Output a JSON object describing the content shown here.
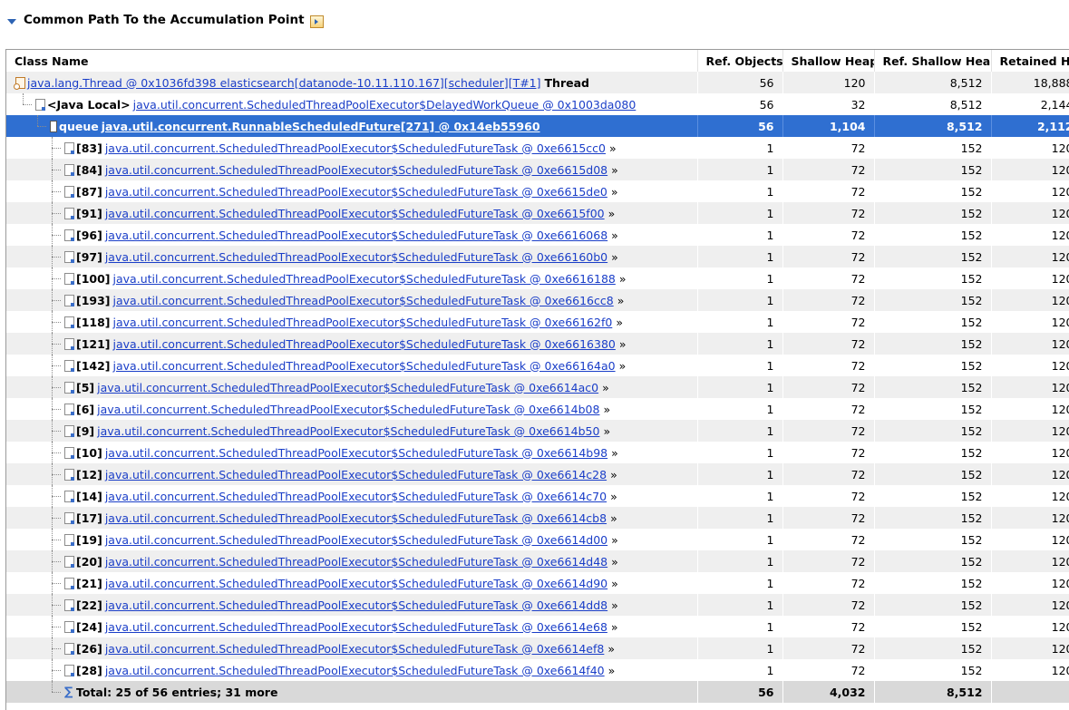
{
  "header": {
    "title": "Common Path To the Accumulation Point"
  },
  "columns": [
    "Class Name",
    "Ref. Objects",
    "Shallow Heap",
    "Ref. Shallow Heap",
    "Retained Heap"
  ],
  "rows": [
    {
      "level": 0,
      "icon": "thread",
      "label": "",
      "link": "java.lang.Thread @ 0x1036fd398 elasticsearch[datanode-10.11.110.167][scheduler][T#1]",
      "suffix": "Thread",
      "more": "",
      "ref": "56",
      "shallow": "120",
      "refshallow": "8,512",
      "retained": "18,888"
    },
    {
      "level": 1,
      "icon": "obj",
      "label": "<Java Local>",
      "link": "java.util.concurrent.ScheduledThreadPoolExecutor$DelayedWorkQueue @ 0x1003da080",
      "suffix": "",
      "more": "",
      "ref": "56",
      "shallow": "32",
      "refshallow": "8,512",
      "retained": "2,144"
    },
    {
      "level": 2,
      "icon": "arr",
      "label": "queue",
      "link": "java.util.concurrent.RunnableScheduledFuture[271] @ 0x14eb55960",
      "suffix": "",
      "more": "",
      "ref": "56",
      "shallow": "1,104",
      "refshallow": "8,512",
      "retained": "2,112",
      "selected": true
    },
    {
      "level": 3,
      "icon": "obj",
      "label": "[83]",
      "link": "java.util.concurrent.ScheduledThreadPoolExecutor$ScheduledFutureTask @ 0xe6615cc0",
      "more": "»",
      "ref": "1",
      "shallow": "72",
      "refshallow": "152",
      "retained": "120"
    },
    {
      "level": 3,
      "icon": "obj",
      "label": "[84]",
      "link": "java.util.concurrent.ScheduledThreadPoolExecutor$ScheduledFutureTask @ 0xe6615d08",
      "more": "»",
      "ref": "1",
      "shallow": "72",
      "refshallow": "152",
      "retained": "120"
    },
    {
      "level": 3,
      "icon": "obj",
      "label": "[87]",
      "link": "java.util.concurrent.ScheduledThreadPoolExecutor$ScheduledFutureTask @ 0xe6615de0",
      "more": "»",
      "ref": "1",
      "shallow": "72",
      "refshallow": "152",
      "retained": "120"
    },
    {
      "level": 3,
      "icon": "obj",
      "label": "[91]",
      "link": "java.util.concurrent.ScheduledThreadPoolExecutor$ScheduledFutureTask @ 0xe6615f00",
      "more": "»",
      "ref": "1",
      "shallow": "72",
      "refshallow": "152",
      "retained": "120"
    },
    {
      "level": 3,
      "icon": "obj",
      "label": "[96]",
      "link": "java.util.concurrent.ScheduledThreadPoolExecutor$ScheduledFutureTask @ 0xe6616068",
      "more": "»",
      "ref": "1",
      "shallow": "72",
      "refshallow": "152",
      "retained": "120"
    },
    {
      "level": 3,
      "icon": "obj",
      "label": "[97]",
      "link": "java.util.concurrent.ScheduledThreadPoolExecutor$ScheduledFutureTask @ 0xe66160b0",
      "more": "»",
      "ref": "1",
      "shallow": "72",
      "refshallow": "152",
      "retained": "120"
    },
    {
      "level": 3,
      "icon": "obj",
      "label": "[100]",
      "link": "java.util.concurrent.ScheduledThreadPoolExecutor$ScheduledFutureTask @ 0xe6616188",
      "more": "»",
      "ref": "1",
      "shallow": "72",
      "refshallow": "152",
      "retained": "120"
    },
    {
      "level": 3,
      "icon": "obj",
      "label": "[193]",
      "link": "java.util.concurrent.ScheduledThreadPoolExecutor$ScheduledFutureTask @ 0xe6616cc8",
      "more": "»",
      "ref": "1",
      "shallow": "72",
      "refshallow": "152",
      "retained": "120"
    },
    {
      "level": 3,
      "icon": "obj",
      "label": "[118]",
      "link": "java.util.concurrent.ScheduledThreadPoolExecutor$ScheduledFutureTask @ 0xe66162f0",
      "more": "»",
      "ref": "1",
      "shallow": "72",
      "refshallow": "152",
      "retained": "120"
    },
    {
      "level": 3,
      "icon": "obj",
      "label": "[121]",
      "link": "java.util.concurrent.ScheduledThreadPoolExecutor$ScheduledFutureTask @ 0xe6616380",
      "more": "»",
      "ref": "1",
      "shallow": "72",
      "refshallow": "152",
      "retained": "120"
    },
    {
      "level": 3,
      "icon": "obj",
      "label": "[142]",
      "link": "java.util.concurrent.ScheduledThreadPoolExecutor$ScheduledFutureTask @ 0xe66164a0",
      "more": "»",
      "ref": "1",
      "shallow": "72",
      "refshallow": "152",
      "retained": "120"
    },
    {
      "level": 3,
      "icon": "obj",
      "label": "[5]",
      "link": "java.util.concurrent.ScheduledThreadPoolExecutor$ScheduledFutureTask @ 0xe6614ac0",
      "more": "»",
      "ref": "1",
      "shallow": "72",
      "refshallow": "152",
      "retained": "120"
    },
    {
      "level": 3,
      "icon": "obj",
      "label": "[6]",
      "link": "java.util.concurrent.ScheduledThreadPoolExecutor$ScheduledFutureTask @ 0xe6614b08",
      "more": "»",
      "ref": "1",
      "shallow": "72",
      "refshallow": "152",
      "retained": "120"
    },
    {
      "level": 3,
      "icon": "obj",
      "label": "[9]",
      "link": "java.util.concurrent.ScheduledThreadPoolExecutor$ScheduledFutureTask @ 0xe6614b50",
      "more": "»",
      "ref": "1",
      "shallow": "72",
      "refshallow": "152",
      "retained": "120"
    },
    {
      "level": 3,
      "icon": "obj",
      "label": "[10]",
      "link": "java.util.concurrent.ScheduledThreadPoolExecutor$ScheduledFutureTask @ 0xe6614b98",
      "more": "»",
      "ref": "1",
      "shallow": "72",
      "refshallow": "152",
      "retained": "120"
    },
    {
      "level": 3,
      "icon": "obj",
      "label": "[12]",
      "link": "java.util.concurrent.ScheduledThreadPoolExecutor$ScheduledFutureTask @ 0xe6614c28",
      "more": "»",
      "ref": "1",
      "shallow": "72",
      "refshallow": "152",
      "retained": "120"
    },
    {
      "level": 3,
      "icon": "obj",
      "label": "[14]",
      "link": "java.util.concurrent.ScheduledThreadPoolExecutor$ScheduledFutureTask @ 0xe6614c70",
      "more": "»",
      "ref": "1",
      "shallow": "72",
      "refshallow": "152",
      "retained": "120"
    },
    {
      "level": 3,
      "icon": "obj",
      "label": "[17]",
      "link": "java.util.concurrent.ScheduledThreadPoolExecutor$ScheduledFutureTask @ 0xe6614cb8",
      "more": "»",
      "ref": "1",
      "shallow": "72",
      "refshallow": "152",
      "retained": "120"
    },
    {
      "level": 3,
      "icon": "obj",
      "label": "[19]",
      "link": "java.util.concurrent.ScheduledThreadPoolExecutor$ScheduledFutureTask @ 0xe6614d00",
      "more": "»",
      "ref": "1",
      "shallow": "72",
      "refshallow": "152",
      "retained": "120"
    },
    {
      "level": 3,
      "icon": "obj",
      "label": "[20]",
      "link": "java.util.concurrent.ScheduledThreadPoolExecutor$ScheduledFutureTask @ 0xe6614d48",
      "more": "»",
      "ref": "1",
      "shallow": "72",
      "refshallow": "152",
      "retained": "120"
    },
    {
      "level": 3,
      "icon": "obj",
      "label": "[21]",
      "link": "java.util.concurrent.ScheduledThreadPoolExecutor$ScheduledFutureTask @ 0xe6614d90",
      "more": "»",
      "ref": "1",
      "shallow": "72",
      "refshallow": "152",
      "retained": "120"
    },
    {
      "level": 3,
      "icon": "obj",
      "label": "[22]",
      "link": "java.util.concurrent.ScheduledThreadPoolExecutor$ScheduledFutureTask @ 0xe6614dd8",
      "more": "»",
      "ref": "1",
      "shallow": "72",
      "refshallow": "152",
      "retained": "120"
    },
    {
      "level": 3,
      "icon": "obj",
      "label": "[24]",
      "link": "java.util.concurrent.ScheduledThreadPoolExecutor$ScheduledFutureTask @ 0xe6614e68",
      "more": "»",
      "ref": "1",
      "shallow": "72",
      "refshallow": "152",
      "retained": "120"
    },
    {
      "level": 3,
      "icon": "obj",
      "label": "[26]",
      "link": "java.util.concurrent.ScheduledThreadPoolExecutor$ScheduledFutureTask @ 0xe6614ef8",
      "more": "»",
      "ref": "1",
      "shallow": "72",
      "refshallow": "152",
      "retained": "120"
    },
    {
      "level": 3,
      "icon": "obj",
      "label": "[28]",
      "link": "java.util.concurrent.ScheduledThreadPoolExecutor$ScheduledFutureTask @ 0xe6614f40",
      "more": "»",
      "ref": "1",
      "shallow": "72",
      "refshallow": "152",
      "retained": "120"
    }
  ],
  "total": {
    "label": "Total: 25 of 56 entries; 31 more",
    "ref": "56",
    "shallow": "4,032",
    "refshallow": "8,512",
    "retained": ""
  },
  "icons": {
    "header": "open-in-view-icon",
    "thread": "thread-icon",
    "object": "object-ref-icon",
    "array": "array-icon",
    "sum": "sigma-icon",
    "expand": "collapse-triangle-icon"
  },
  "colors": {
    "selection": "#2f6fd1",
    "link": "#1a3ec8",
    "stripe": "#efefef",
    "total": "#d9d9d9"
  }
}
